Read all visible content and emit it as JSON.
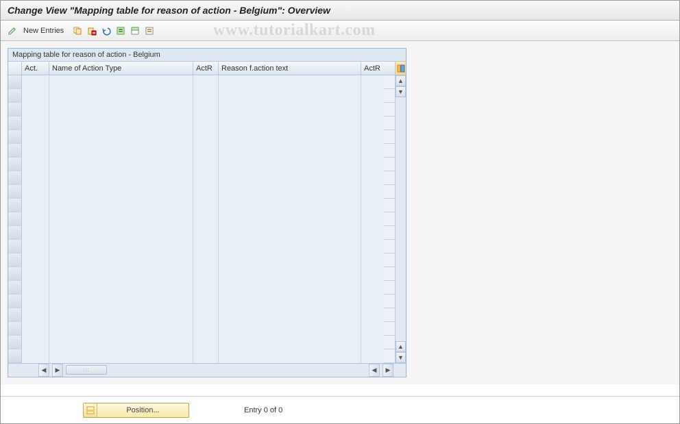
{
  "header": {
    "title": "Change View \"Mapping table for reason of action - Belgium\": Overview"
  },
  "toolbar": {
    "change_icon": "change-icon",
    "new_entries_label": "New Entries",
    "copy_icon": "copy-icon",
    "delete_icon": "delete-icon",
    "undo_icon": "undo-icon",
    "select_all_icon": "select-all-icon",
    "select_block_icon": "select-block-icon",
    "deselect_icon": "deselect-icon"
  },
  "watermark": "www.tutorialkart.com",
  "table": {
    "title": "Mapping table for reason of action - Belgium",
    "columns": {
      "act": "Act.",
      "name": "Name of Action Type",
      "actr1": "ActR",
      "reason": "Reason f.action text",
      "actr2": "ActR"
    },
    "row_count": 21
  },
  "footer": {
    "position_label": "Position...",
    "entry_status": "Entry 0 of 0"
  }
}
